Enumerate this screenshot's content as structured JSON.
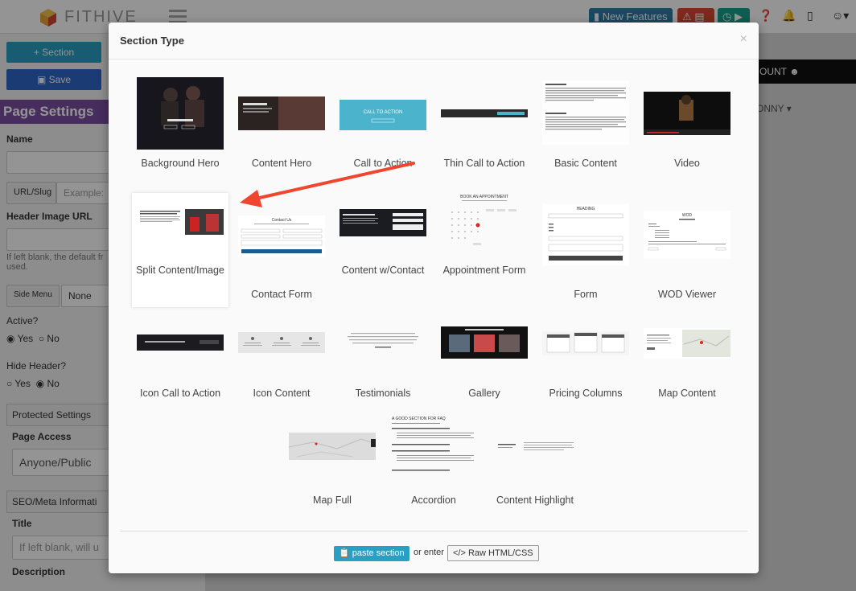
{
  "app": {
    "brand": "FITHIVE",
    "topbar": {
      "new_features": "New Features",
      "brand_color": "#2a9fc4"
    },
    "left_panel": {
      "section_button": "Section",
      "save_button": "Save",
      "page_settings": "Page Settings",
      "name_label": "Name",
      "url_slug_button": "URL/Slug",
      "url_placeholder": "Example:",
      "header_image_label": "Header Image URL",
      "header_help": "If left blank, the default fr used.",
      "side_menu_button": "Side Menu",
      "side_menu_value": "None",
      "active_label": "Active?",
      "yes": "Yes",
      "no": "No",
      "hide_header_label": "Hide Header?",
      "protected_settings": "Protected Settings",
      "page_access_label": "Page Access",
      "page_access_value": "Anyone/Public",
      "seo_meta": "SEO/Meta Informati",
      "title_label": "Title",
      "title_placeholder": "If left blank, will u",
      "description_label": "Description"
    },
    "right_panel": {
      "account_text": "OUNT",
      "user_text": "ONNY"
    }
  },
  "modal": {
    "title": "Section Type",
    "close": "×",
    "sections": [
      {
        "label": "Background Hero"
      },
      {
        "label": "Content Hero"
      },
      {
        "label": "Call to Action",
        "thumb_text": "CALL TO ACTION"
      },
      {
        "label": "Thin Call to Action"
      },
      {
        "label": "Basic Content"
      },
      {
        "label": "Video"
      },
      {
        "label": "Split Content/Image",
        "highlighted": true
      },
      {
        "label": "Contact Form",
        "thumb_text": "Contact Us"
      },
      {
        "label": "Content w/Contact"
      },
      {
        "label": "Appointment Form",
        "thumb_text": "BOOK AN APPOINTMENT"
      },
      {
        "label": "Form",
        "thumb_text": "HEADING"
      },
      {
        "label": "WOD Viewer",
        "thumb_text": "WOD"
      },
      {
        "label": "Icon Call to Action"
      },
      {
        "label": "Icon Content"
      },
      {
        "label": "Testimonials"
      },
      {
        "label": "Gallery"
      },
      {
        "label": "Pricing Columns"
      },
      {
        "label": "Map Content"
      },
      {
        "label": "Map Full"
      },
      {
        "label": "Accordion",
        "thumb_text": "A GOOD SECTION FOR FAQ"
      },
      {
        "label": "Content Highlight"
      }
    ],
    "footer": {
      "paste_button": "paste section",
      "or_enter": "or enter",
      "raw_button": "Raw HTML/CSS"
    }
  },
  "annotation": {
    "arrow_color": "#f0452f"
  }
}
